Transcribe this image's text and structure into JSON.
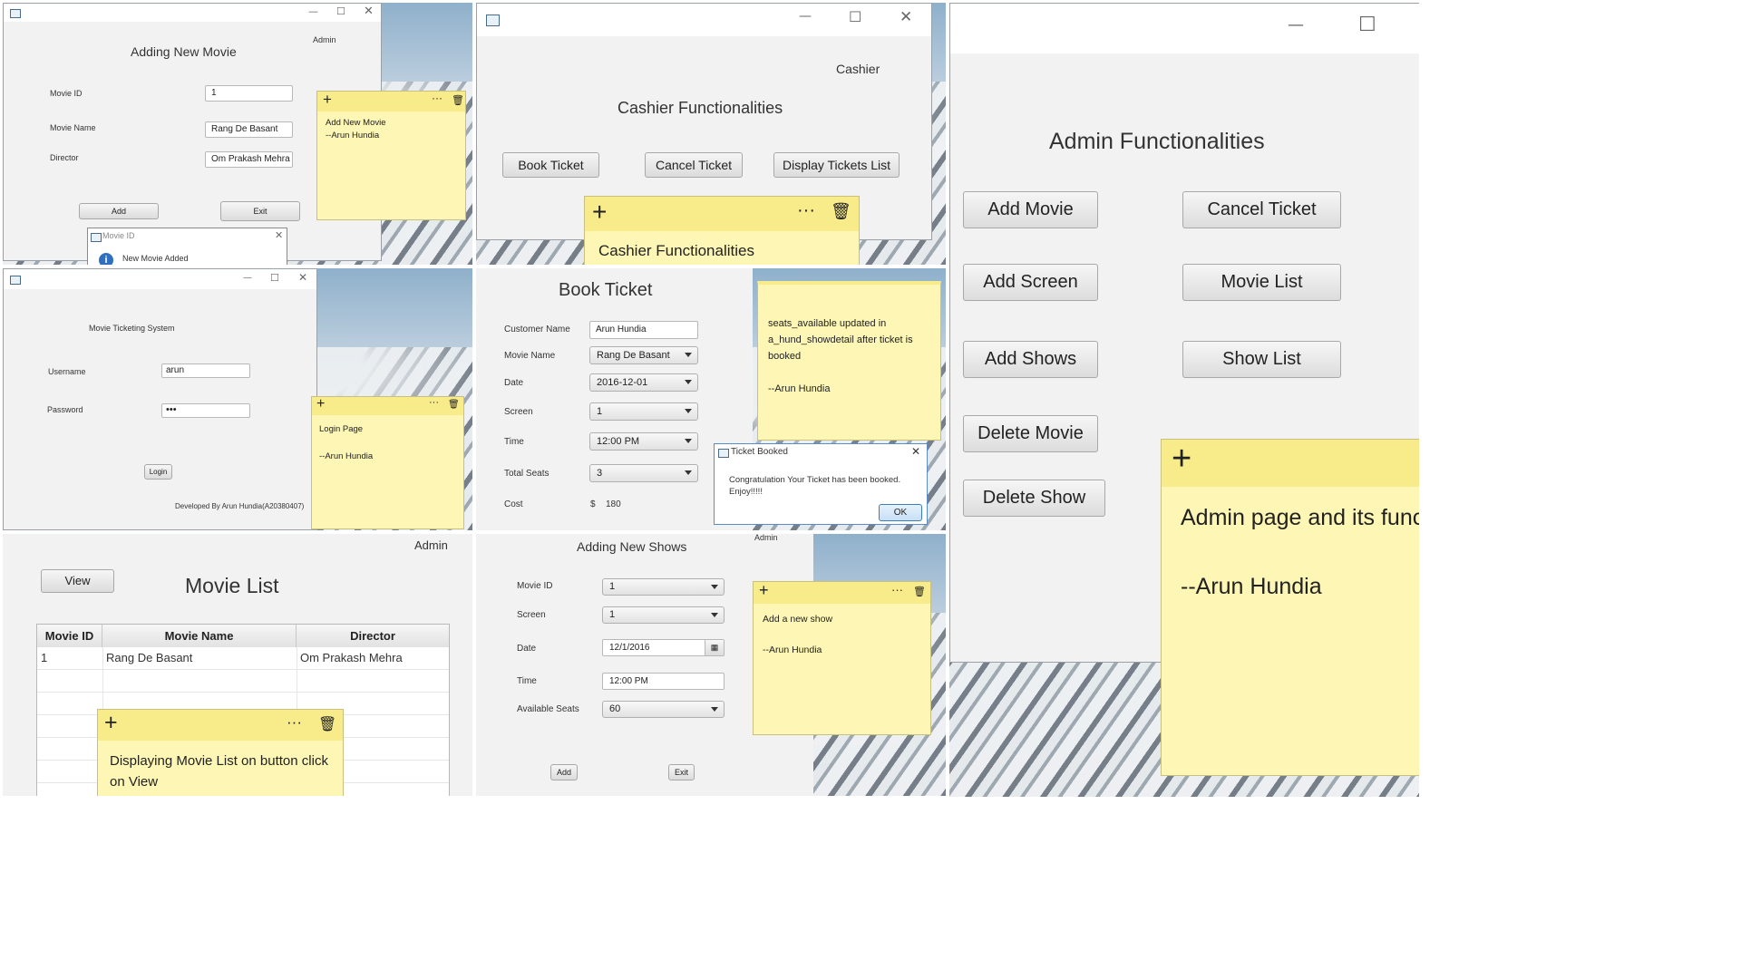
{
  "add_movie_panel": {
    "title": "Adding New Movie",
    "role": "Admin",
    "labels": {
      "movie_id": "Movie ID",
      "movie_name": "Movie Name",
      "director": "Director"
    },
    "values": {
      "movie_id": "1",
      "movie_name": "Rang De Basant",
      "director": "Om Prakash Mehra"
    },
    "add_label": "Add",
    "exit_label": "Exit",
    "dialog": {
      "title": "Movie ID",
      "message": "New Movie Added"
    },
    "note": {
      "text": "Add New Movie\n--Arun Hundia"
    }
  },
  "cashier_panel": {
    "role": "Cashier",
    "title": "Cashier Functionalities",
    "buttons": {
      "book": "Book Ticket",
      "cancel": "Cancel Ticket",
      "display": "Display Tickets List"
    },
    "note": {
      "text": "Cashier Functionalities"
    }
  },
  "admin_panel": {
    "title": "Admin Functionalities",
    "buttons": {
      "add_movie": "Add Movie",
      "add_screen": "Add Screen",
      "add_shows": "Add Shows",
      "delete_movie": "Delete Movie",
      "delete_show": "Delete Show",
      "cancel_ticket": "Cancel Ticket",
      "movie_list": "Movie List",
      "show_list": "Show List"
    },
    "note": {
      "line1": "Admin page and its funct",
      "line2": "--Arun Hundia"
    }
  },
  "login_panel": {
    "title": "Movie Ticketing System",
    "labels": {
      "username": "Username",
      "password": "Password"
    },
    "values": {
      "username": "arun",
      "password": "•••"
    },
    "login_label": "Login",
    "footer": "Developed By Arun Hundia(A20380407)",
    "note": {
      "text": "Login Page\n\n--Arun Hundia"
    }
  },
  "book_panel": {
    "title": "Book Ticket",
    "labels": {
      "customer": "Customer Name",
      "movie": "Movie Name",
      "date": "Date",
      "screen": "Screen",
      "time": "Time",
      "seats": "Total Seats",
      "cost": "Cost"
    },
    "values": {
      "customer": "Arun Hundia",
      "movie": "Rang De Basant",
      "date": "2016-12-01",
      "screen": "1",
      "time": "12:00 PM",
      "seats": "3",
      "currency": "$",
      "cost": "180"
    },
    "note": {
      "text": "seats_available updated in a_hund_showdetail after ticket is booked\n\n--Arun Hundia"
    },
    "dialog": {
      "title": "Ticket Booked",
      "message": "Congratulation Your Ticket has been booked. Enjoy!!!!!",
      "ok": "OK"
    }
  },
  "movie_list_panel": {
    "role": "Admin",
    "view_label": "View",
    "title": "Movie List",
    "columns": [
      "Movie ID",
      "Movie Name",
      "Director"
    ],
    "rows": [
      [
        "1",
        "Rang De Basant",
        "Om Prakash Mehra"
      ]
    ],
    "note": {
      "text": "Displaying Movie List on button click on View"
    }
  },
  "add_shows_panel": {
    "title": "Adding New Shows",
    "role": "Admin",
    "labels": {
      "movie_id": "Movie ID",
      "screen": "Screen",
      "date": "Date",
      "time": "Time",
      "seats": "Available Seats"
    },
    "values": {
      "movie_id": "1",
      "screen": "1",
      "date": "12/1/2016",
      "time": "12:00 PM",
      "seats": "60"
    },
    "add_label": "Add",
    "exit_label": "Exit",
    "note": {
      "text": "Add a new show\n\n--Arun Hundia"
    }
  },
  "icons": {
    "plus": "plus-icon",
    "more": "more-icon",
    "trash": "trash-icon",
    "info": "info-icon",
    "calendar": "calendar-icon"
  }
}
